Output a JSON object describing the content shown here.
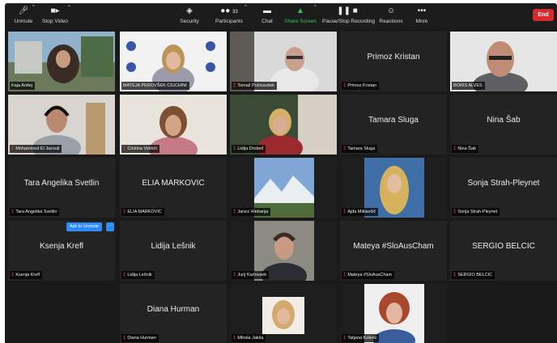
{
  "toolbar": {
    "unmute": "Unmute",
    "stop_video": "Stop Video",
    "security": "Security",
    "participants": "Participants",
    "participants_count": "33",
    "chat": "Chat",
    "share_screen": "Share Screen",
    "recording": "Pause/Stop Recording",
    "reactions": "Reactions",
    "more": "More",
    "end": "End"
  },
  "ask_to_unmute": "Ask to Unmute",
  "more_dots": "···",
  "participants": [
    {
      "name": "Kaja Antlej",
      "video": true
    },
    {
      "name": "MATEJA PEROVŠEK CIUCHINI",
      "video": true
    },
    {
      "name": "Tomaž Počivavšek",
      "video": true
    },
    {
      "name": "Primoz Kristan",
      "video": false
    },
    {
      "name": "BORIS ALVES",
      "video": true
    },
    {
      "name": "Mohammed El Jazouli",
      "video": true
    },
    {
      "name": "Cristina Vidrich",
      "video": true
    },
    {
      "name": "Lidija Drobež",
      "video": true
    },
    {
      "name": "Tamara Sluga",
      "video": false
    },
    {
      "name": "Nina Šab",
      "video": false
    },
    {
      "name": "Tara Angelika Svetlin",
      "video": false
    },
    {
      "name": "ELIA MARKOVIC",
      "video": false
    },
    {
      "name": "Janez Hlebanja",
      "video": true
    },
    {
      "name": "Ajda Miklavčič",
      "video": true
    },
    {
      "name": "Sonja Strah-Pleynet",
      "video": false
    },
    {
      "name": "Ksenja Krefl",
      "video": false
    },
    {
      "name": "Lidija Lešnik",
      "video": false
    },
    {
      "name": "Jurij Karlovsek",
      "video": true
    },
    {
      "name": "Mateya #SloAusCham",
      "video": false
    },
    {
      "name": "SERGIO BELCIC",
      "video": false
    },
    {
      "name": "Diana Hurman",
      "video": false
    },
    {
      "name": "Mihela Jakša",
      "video": true
    },
    {
      "name": "Tatjana Kolenc",
      "video": true
    }
  ],
  "colors": {
    "toolbar_bg": "#1c1c1c",
    "tile_bg": "#232323",
    "active_border": "#c4d93a",
    "end_red": "#d72b2b",
    "share_green": "#36c45a"
  }
}
